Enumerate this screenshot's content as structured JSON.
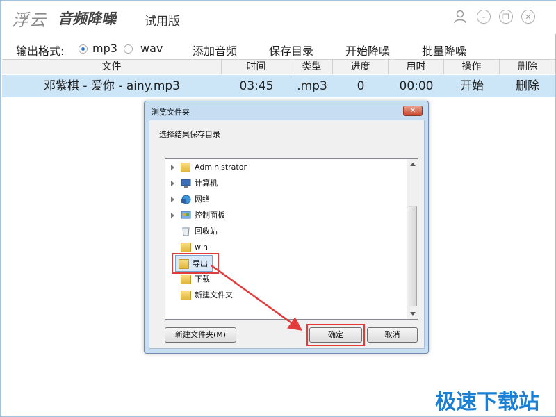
{
  "app": {
    "logo_main": "浮云",
    "logo_sub": "音频降噪",
    "edition": "试用版"
  },
  "toolbar": {
    "format_label": "输出格式:",
    "options": [
      "mp3",
      "wav"
    ],
    "selected": "mp3",
    "actions": [
      "添加音频",
      "保存目录",
      "开始降噪",
      "批量降噪"
    ]
  },
  "table": {
    "headers": [
      "文件",
      "时间",
      "类型",
      "进度",
      "用时",
      "操作",
      "删除"
    ],
    "rows": [
      [
        "邓紫棋 - 爱你 - ainy.mp3",
        "03:45",
        ".mp3",
        "0",
        "00:00",
        "开始",
        "删除"
      ]
    ]
  },
  "dialog": {
    "title": "浏览文件夹",
    "close_label": "✕",
    "prompt": "选择结果保存目录",
    "tree": [
      {
        "label": "Administrator",
        "icon": "user-folder-icon",
        "expandable": true
      },
      {
        "label": "计算机",
        "icon": "computer-icon",
        "expandable": true
      },
      {
        "label": "网络",
        "icon": "network-icon",
        "expandable": true
      },
      {
        "label": "控制面板",
        "icon": "control-panel-icon",
        "expandable": true
      },
      {
        "label": "回收站",
        "icon": "recycle-bin-icon",
        "expandable": false
      },
      {
        "label": "win",
        "icon": "folder-icon",
        "expandable": false
      },
      {
        "label": "导出",
        "icon": "folder-icon",
        "expandable": false,
        "selected": true
      },
      {
        "label": "下载",
        "icon": "folder-icon",
        "expandable": false
      },
      {
        "label": "新建文件夹",
        "icon": "folder-icon",
        "expandable": false
      }
    ],
    "new_folder_button": "新建文件夹(M)",
    "ok_button": "确定",
    "cancel_button": "取消"
  },
  "watermark": "极速下载站",
  "colors": {
    "row_selected": "#cde6f7",
    "highlight": "#e23b3b",
    "watermark": "#1a80d4"
  }
}
